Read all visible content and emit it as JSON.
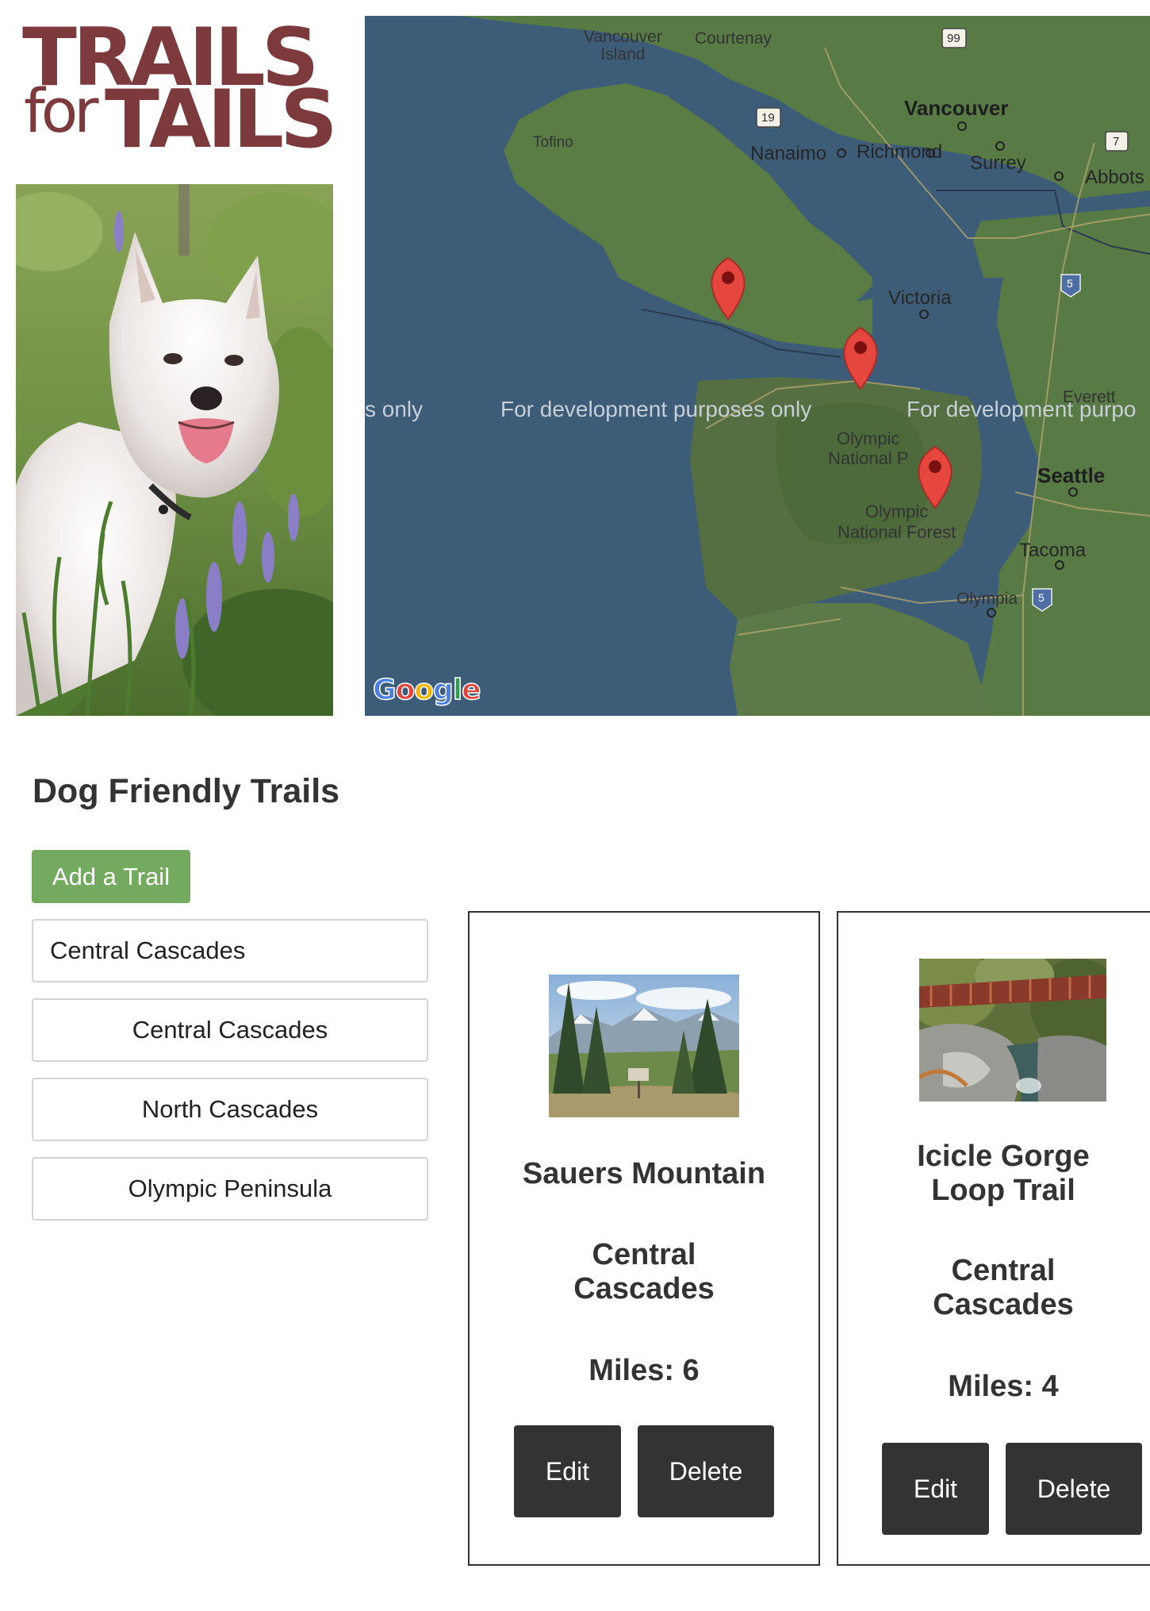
{
  "logo": {
    "line1": "TRAILS",
    "line2a": "for",
    "line2b": "TAILS",
    "color": "#7d3a3d"
  },
  "map": {
    "cities": {
      "vancouver_island": "Vancouver\nIsland",
      "courtenay": "Courtenay",
      "vancouver": "Vancouver",
      "tofino": "Tofino",
      "nanaimo": "Nanaimo",
      "richmond": "Richmond",
      "surrey": "Surrey",
      "abbotsford": "Abbots",
      "victoria": "Victoria",
      "everett": "Everett",
      "olympic_np": "Olympic\nNational P",
      "olympic_nf": "Olympic\nNational Forest",
      "seattle": "Seattle",
      "tacoma": "Tacoma",
      "olympia": "Olympia"
    },
    "highway_shields": [
      "99",
      "19",
      "7",
      "5",
      "5"
    ],
    "dev_watermark_left": "s only",
    "dev_watermark_center": "For development purposes only",
    "dev_watermark_right": "For development purpo",
    "attribution": "Google",
    "water_color": "#3c5c78",
    "land_color": "#5c7a48",
    "marker_color": "#e5463d",
    "marker_count": 3
  },
  "page": {
    "title": "Dog Friendly Trails",
    "add_button": "Add a Trail",
    "add_button_color": "#73aa5f"
  },
  "filters": [
    {
      "label": "Central Cascades"
    },
    {
      "label": "Central Cascades"
    },
    {
      "label": "North Cascades"
    },
    {
      "label": "Olympic Peninsula"
    }
  ],
  "trails": [
    {
      "name": "Sauers Mountain",
      "region": "Central\nCascades",
      "miles": "Miles: 6",
      "edit_label": "Edit",
      "delete_label": "Delete"
    },
    {
      "name": "Icicle Gorge\nLoop Trail",
      "region": "Central\nCascades",
      "miles": "Miles: 4",
      "edit_label": "Edit",
      "delete_label": "Delete"
    }
  ]
}
